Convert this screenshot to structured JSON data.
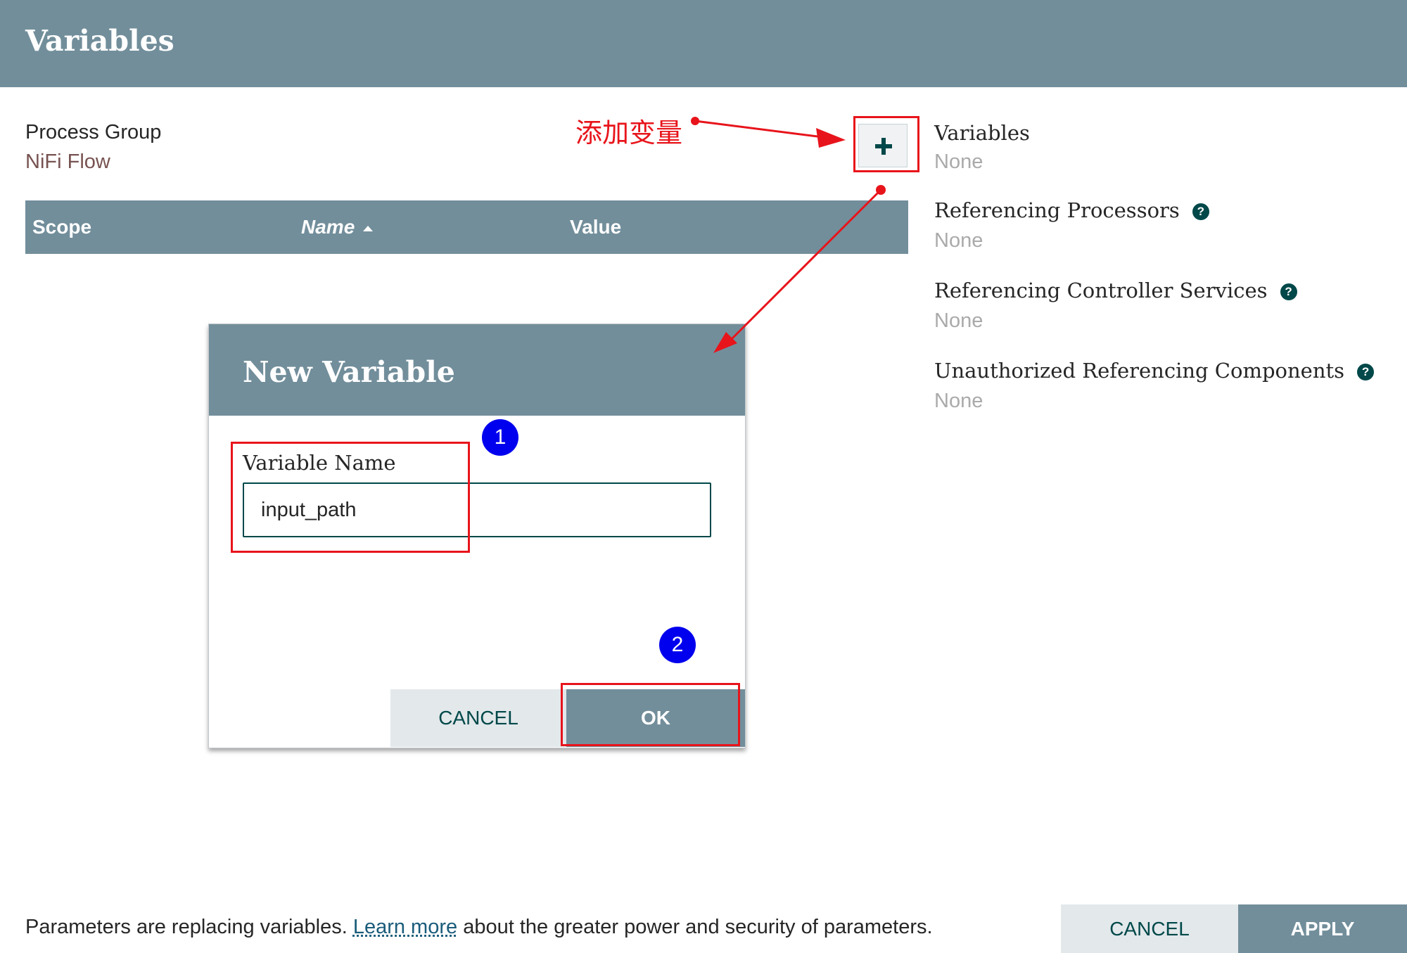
{
  "header": {
    "title": "Variables"
  },
  "process_group": {
    "label": "Process Group",
    "value": "NiFi Flow"
  },
  "table": {
    "columns": [
      {
        "label": "Scope"
      },
      {
        "label": "Name"
      },
      {
        "label": "Value"
      }
    ],
    "sort_icon": "sort-ascending-icon"
  },
  "add_button": {
    "icon": "plus-icon"
  },
  "right_panel": {
    "variables": {
      "label": "Variables",
      "value": "None"
    },
    "referencing_processors": {
      "label": "Referencing Processors",
      "value": "None"
    },
    "referencing_controller_services": {
      "label": "Referencing Controller Services",
      "value": "None"
    },
    "unauthorized_referencing_components": {
      "label": "Unauthorized Referencing Components",
      "value": "None"
    },
    "help_icon": "question-circle-icon"
  },
  "dialog": {
    "title": "New Variable",
    "field_label": "Variable Name",
    "field_value": "input_path",
    "cancel_label": "CANCEL",
    "ok_label": "OK"
  },
  "footer": {
    "text_before": "Parameters are replacing variables. ",
    "link": "Learn more",
    "text_after": " about the greater power and security of parameters.",
    "cancel_label": "CANCEL",
    "apply_label": "APPLY"
  },
  "annotations": {
    "add_variable_text": "添加变量",
    "step1": "1",
    "step2": "2",
    "color": "#e8141b",
    "badge_color": "#0000ee"
  },
  "colors": {
    "header_bg": "#728e9b",
    "accent": "#004849",
    "link": "#775351"
  }
}
